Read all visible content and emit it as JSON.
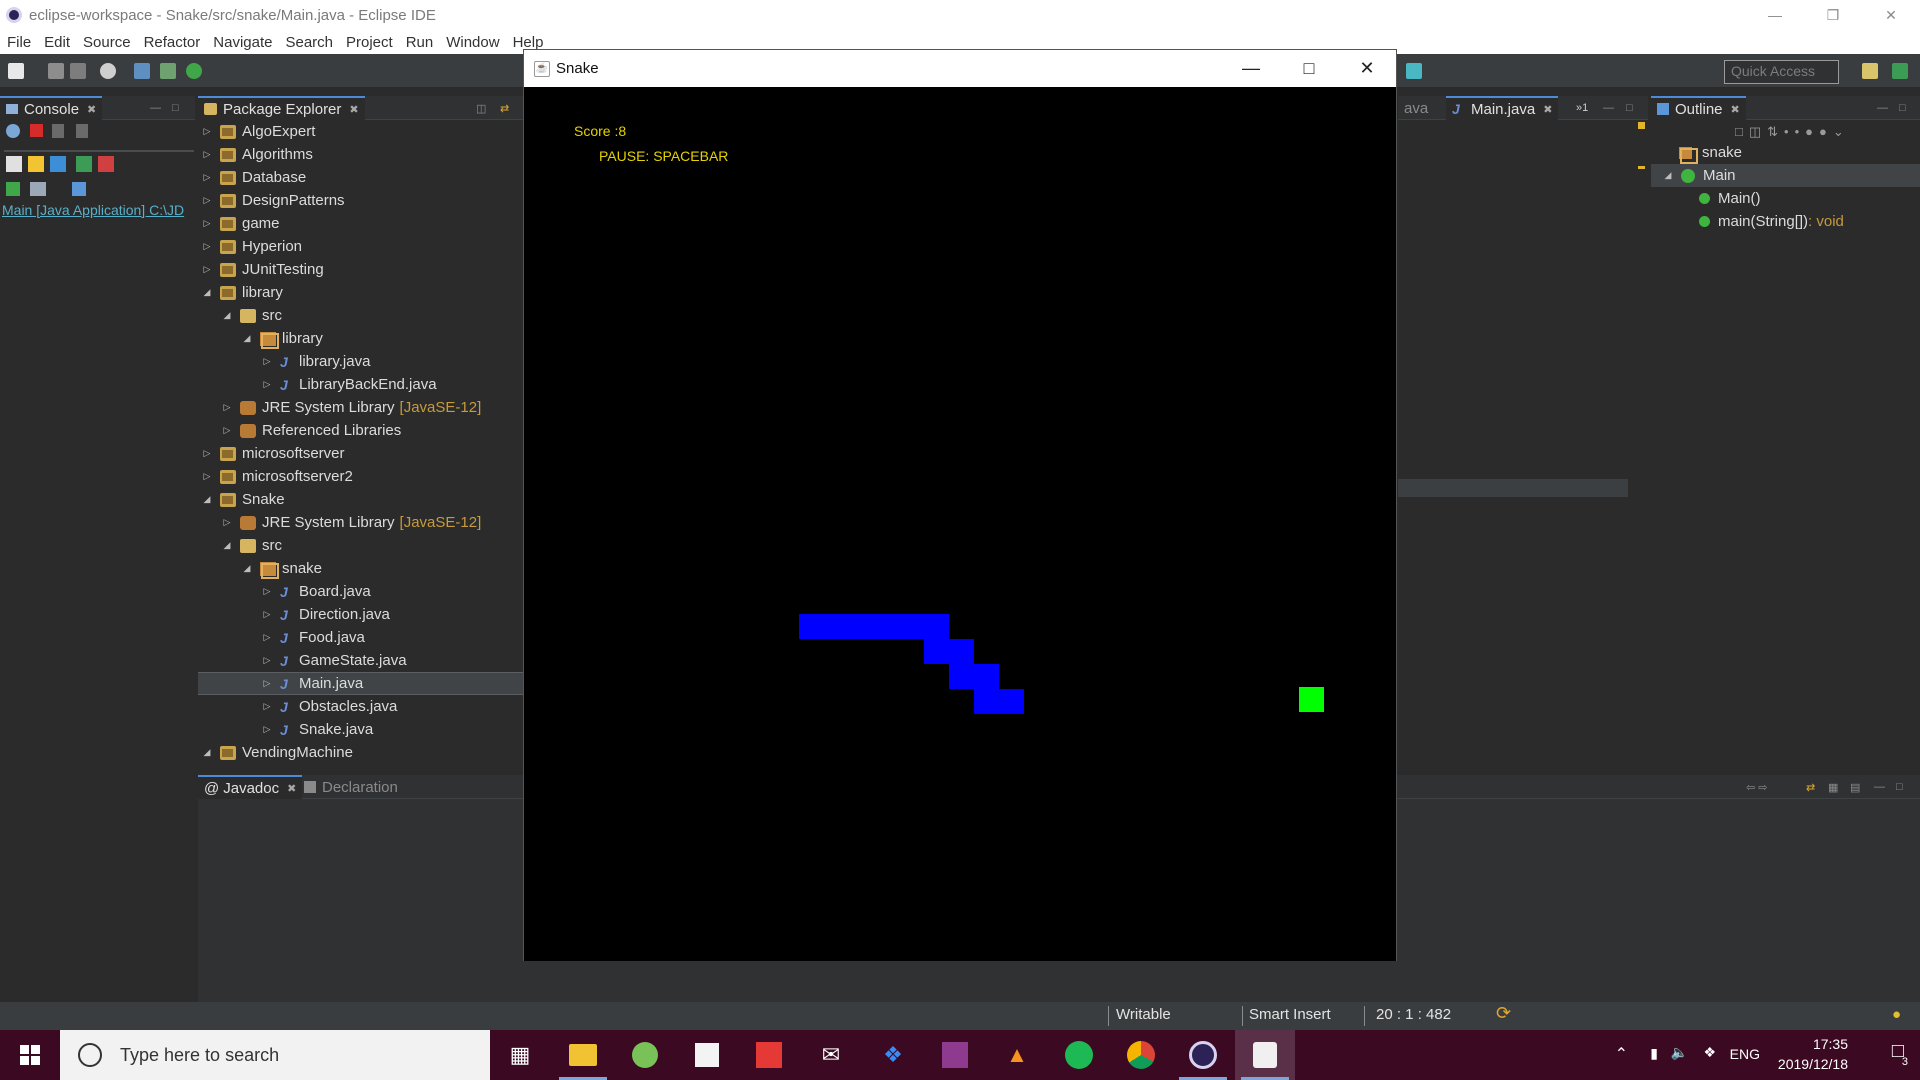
{
  "window": {
    "title": "eclipse-workspace - Snake/src/snake/Main.java - Eclipse IDE",
    "controls": [
      "minimize",
      "restore",
      "close"
    ]
  },
  "menubar": [
    "File",
    "Edit",
    "Source",
    "Refactor",
    "Navigate",
    "Search",
    "Project",
    "Run",
    "Window",
    "Help"
  ],
  "toolbar": {
    "quick_access_placeholder": "Quick Access"
  },
  "console": {
    "tab_label": "Console",
    "run_label": "Main [Java Application] C:\\JD"
  },
  "package_explorer": {
    "tab_label": "Package Explorer",
    "nodes": [
      {
        "label": "AlgoExpert",
        "type": "project",
        "depth": 0,
        "expanded": false
      },
      {
        "label": "Algorithms",
        "type": "project",
        "depth": 0,
        "expanded": false
      },
      {
        "label": "Database",
        "type": "project",
        "depth": 0,
        "expanded": false
      },
      {
        "label": "DesignPatterns",
        "type": "project",
        "depth": 0,
        "expanded": false
      },
      {
        "label": "game",
        "type": "project",
        "depth": 0,
        "expanded": false
      },
      {
        "label": "Hyperion",
        "type": "project",
        "depth": 0,
        "expanded": false
      },
      {
        "label": "JUnitTesting",
        "type": "project",
        "depth": 0,
        "expanded": false
      },
      {
        "label": "library",
        "type": "project",
        "depth": 0,
        "expanded": true
      },
      {
        "label": "src",
        "type": "folder",
        "depth": 1,
        "expanded": true
      },
      {
        "label": "library",
        "type": "package",
        "depth": 2,
        "expanded": true
      },
      {
        "label": "library.java",
        "type": "java",
        "depth": 3,
        "expanded": false
      },
      {
        "label": "LibraryBackEnd.java",
        "type": "java",
        "depth": 3,
        "expanded": false
      },
      {
        "label": "JRE System Library",
        "decoration": "[JavaSE-12]",
        "type": "jar",
        "depth": 1,
        "expanded": false
      },
      {
        "label": "Referenced Libraries",
        "type": "jar",
        "depth": 1,
        "expanded": false
      },
      {
        "label": "microsoftserver",
        "type": "project",
        "depth": 0,
        "expanded": false
      },
      {
        "label": "microsoftserver2",
        "type": "project",
        "depth": 0,
        "expanded": false
      },
      {
        "label": "Snake",
        "type": "project",
        "depth": 0,
        "expanded": true
      },
      {
        "label": "JRE System Library",
        "decoration": "[JavaSE-12]",
        "type": "jar",
        "depth": 1,
        "expanded": false
      },
      {
        "label": "src",
        "type": "folder",
        "depth": 1,
        "expanded": true
      },
      {
        "label": "snake",
        "type": "package",
        "depth": 2,
        "expanded": true
      },
      {
        "label": "Board.java",
        "type": "java",
        "depth": 3,
        "expanded": false
      },
      {
        "label": "Direction.java",
        "type": "java",
        "depth": 3,
        "expanded": false
      },
      {
        "label": "Food.java",
        "type": "java",
        "depth": 3,
        "expanded": false
      },
      {
        "label": "GameState.java",
        "type": "java",
        "depth": 3,
        "expanded": false
      },
      {
        "label": "Main.java",
        "type": "java",
        "depth": 3,
        "expanded": false,
        "selected": true
      },
      {
        "label": "Obstacles.java",
        "type": "java",
        "depth": 3,
        "expanded": false
      },
      {
        "label": "Snake.java",
        "type": "java",
        "depth": 3,
        "expanded": false
      },
      {
        "label": "VendingMachine",
        "type": "project",
        "depth": 0,
        "expanded": true
      }
    ]
  },
  "editor": {
    "tab_partial": "ava",
    "tab_label": "Main.java",
    "overflow_label": "»1"
  },
  "outline": {
    "tab_label": "Outline",
    "package": "snake",
    "class": "Main",
    "members": [
      {
        "label": "Main()",
        "suffix": ""
      },
      {
        "label": "main(String[])",
        "suffix": " : void"
      }
    ]
  },
  "bottom_panel": {
    "javadoc_label": "Javadoc",
    "declaration_label": "Declaration"
  },
  "statusbar": {
    "writable": "Writable",
    "insert_mode": "Smart Insert",
    "position": "20 : 1 : 482"
  },
  "snake_window": {
    "title": "Snake",
    "score_text": "Score :8",
    "pause_text": "PAUSE: SPACEBAR",
    "snake_color": "#0000ff",
    "food_color": "#00ff00",
    "background": "#000000"
  },
  "taskbar": {
    "search_placeholder": "Type here to search",
    "language": "ENG",
    "time": "17:35",
    "date": "2019/12/18",
    "notification_count": "3",
    "apps": [
      "task-view",
      "file-explorer",
      "android-studio",
      "microsoft-store",
      "gift",
      "mail",
      "dropbox",
      "winrar",
      "vlc",
      "spotify",
      "chrome",
      "eclipse",
      "java"
    ]
  }
}
